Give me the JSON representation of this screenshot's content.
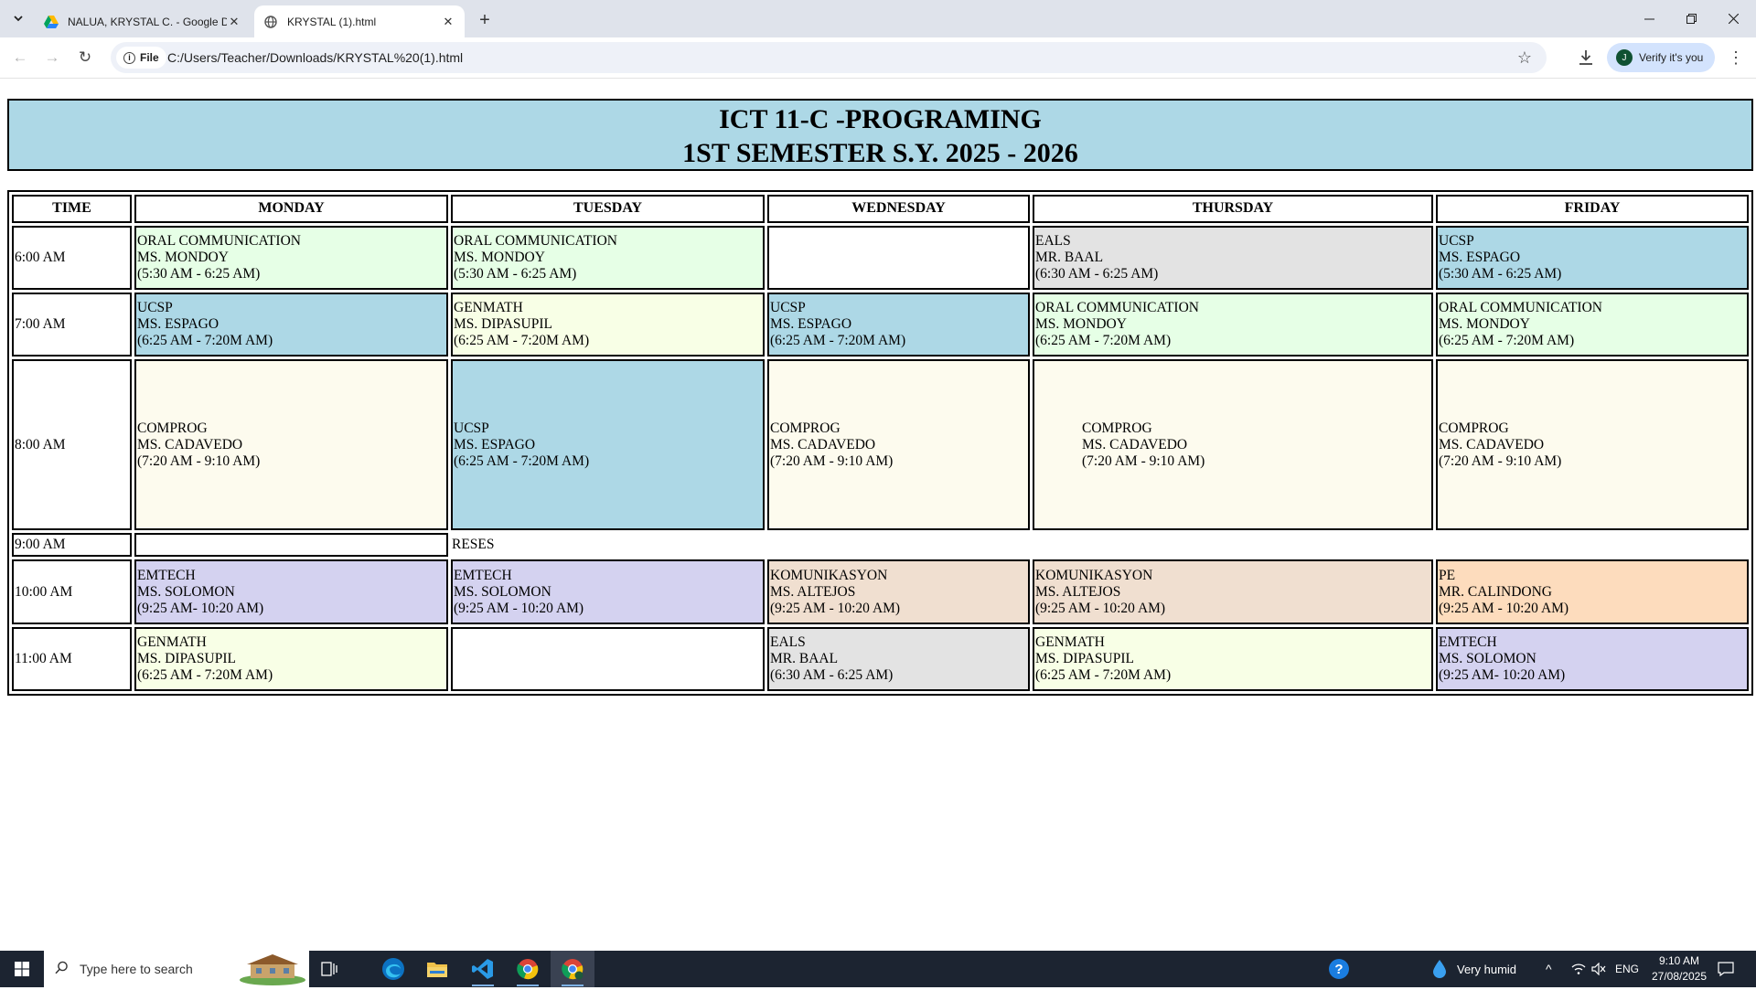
{
  "browser": {
    "tabs": [
      {
        "title": "NALUA, KRYSTAL C. - Google D",
        "icon": "google-drive-icon"
      },
      {
        "title": "KRYSTAL (1).html",
        "icon": "globe-icon"
      }
    ],
    "address_chip": "File",
    "url": "C:/Users/Teacher/Downloads/KRYSTAL%20(1).html",
    "profile_initial": "J",
    "verify_label": "Verify it's you"
  },
  "page": {
    "title_line1": "ICT 11-C -PROGRAMING",
    "title_line2": "1ST SEMESTER S.Y. 2025 - 2026"
  },
  "schedule": {
    "headers": {
      "time": "TIME",
      "monday": "MONDAY",
      "tuesday": "TUESDAY",
      "wednesday": "WEDNESDAY",
      "thursday": "THURSDAY",
      "friday": "FRIDAY"
    },
    "rows": {
      "r6": {
        "time": "6:00 AM",
        "mon": {
          "subject": "ORAL COMMUNICATION",
          "teacher": "MS. MONDOY",
          "hours": "(5:30 AM - 6:25 AM)"
        },
        "tue": {
          "subject": "ORAL COMMUNICATION",
          "teacher": "MS. MONDOY",
          "hours": "(5:30 AM - 6:25 AM)"
        },
        "thu": {
          "subject": "EALS",
          "teacher": "MR. BAAL",
          "hours": "(6:30 AM - 6:25 AM)"
        },
        "fri": {
          "subject": "UCSP",
          "teacher": "MS. ESPAGO",
          "hours": "(5:30 AM - 6:25 AM)"
        }
      },
      "r7": {
        "time": "7:00 AM",
        "mon": {
          "subject": "UCSP",
          "teacher": "MS. ESPAGO",
          "hours": "(6:25 AM - 7:20M AM)"
        },
        "tue": {
          "subject": "GENMATH",
          "teacher": "MS. DIPASUPIL",
          "hours": "(6:25 AM - 7:20M AM)"
        },
        "wed": {
          "subject": "UCSP",
          "teacher": "MS. ESPAGO",
          "hours": "(6:25 AM - 7:20M AM)"
        },
        "thu": {
          "subject": "ORAL COMMUNICATION",
          "teacher": "MS. MONDOY",
          "hours": "(6:25 AM - 7:20M AM)"
        },
        "fri": {
          "subject": "ORAL COMMUNICATION",
          "teacher": "MS. MONDOY",
          "hours": "(6:25 AM - 7:20M AM)"
        }
      },
      "r8": {
        "time": "8:00 AM",
        "mon": {
          "subject": "COMPROG",
          "teacher": "MS. CADAVEDO",
          "hours": "(7:20 AM - 9:10 AM)"
        },
        "tue": {
          "subject": "UCSP",
          "teacher": "MS. ESPAGO",
          "hours": "(6:25 AM - 7:20M AM)"
        },
        "wed": {
          "subject": "COMPROG",
          "teacher": "MS. CADAVEDO",
          "hours": "(7:20 AM - 9:10 AM)"
        },
        "thu": {
          "subject": "COMPROG",
          "teacher": "MS. CADAVEDO",
          "hours": "(7:20 AM - 9:10 AM)"
        },
        "fri": {
          "subject": "COMPROG",
          "teacher": "MS. CADAVEDO",
          "hours": "(7:20 AM - 9:10 AM)"
        }
      },
      "r9": {
        "time": "9:00 AM",
        "break_label": "RESES"
      },
      "r10": {
        "time": "10:00 AM",
        "mon": {
          "subject": "EMTECH",
          "teacher": "MS. SOLOMON",
          "hours": "(9:25 AM- 10:20 AM)"
        },
        "tue": {
          "subject": "EMTECH",
          "teacher": "MS. SOLOMON",
          "hours": "(9:25 AM - 10:20 AM)"
        },
        "wed": {
          "subject": "KOMUNIKASYON",
          "teacher": "MS. ALTEJOS",
          "hours": "(9:25 AM - 10:20 AM)"
        },
        "thu": {
          "subject": "KOMUNIKASYON",
          "teacher": "MS. ALTEJOS",
          "hours": "(9:25 AM - 10:20 AM)"
        },
        "fri": {
          "subject": "PE",
          "teacher": "MR. CALINDONG",
          "hours": "(9:25 AM - 10:20 AM)"
        }
      },
      "r11": {
        "time": "11:00 AM",
        "mon": {
          "subject": "GENMATH",
          "teacher": "MS. DIPASUPIL",
          "hours": "(6:25 AM - 7:20M AM)"
        },
        "wed": {
          "subject": "EALS",
          "teacher": "MR. BAAL",
          "hours": "(6:30 AM - 6:25 AM)"
        },
        "thu": {
          "subject": "GENMATH",
          "teacher": "MS. DIPASUPIL",
          "hours": "(6:25 AM - 7:20M AM)"
        },
        "fri": {
          "subject": "EMTECH",
          "teacher": "MS. SOLOMON",
          "hours": "(9:25 AM- 10:20 AM)"
        }
      }
    }
  },
  "colors": {
    "header_bg": "#add8e6",
    "oral_comm": "#e6ffe6",
    "ucsp": "#add8e6",
    "eals": "#e3e3e3",
    "genmath": "#f8ffe6",
    "comprog": "#fdfbee",
    "emtech": "#d4d2f0",
    "komunikasyon": "#f0dfd0",
    "pe": "#fddcbd"
  },
  "taskbar": {
    "search_placeholder": "Type here to search",
    "weather": "Very humid",
    "language": "ENG",
    "time": "9:10 AM",
    "date": "27/08/2025",
    "apps": [
      "task-view-icon",
      "edge-icon",
      "file-explorer-icon",
      "vscode-icon",
      "chrome-icon",
      "chrome-profile-icon"
    ]
  }
}
